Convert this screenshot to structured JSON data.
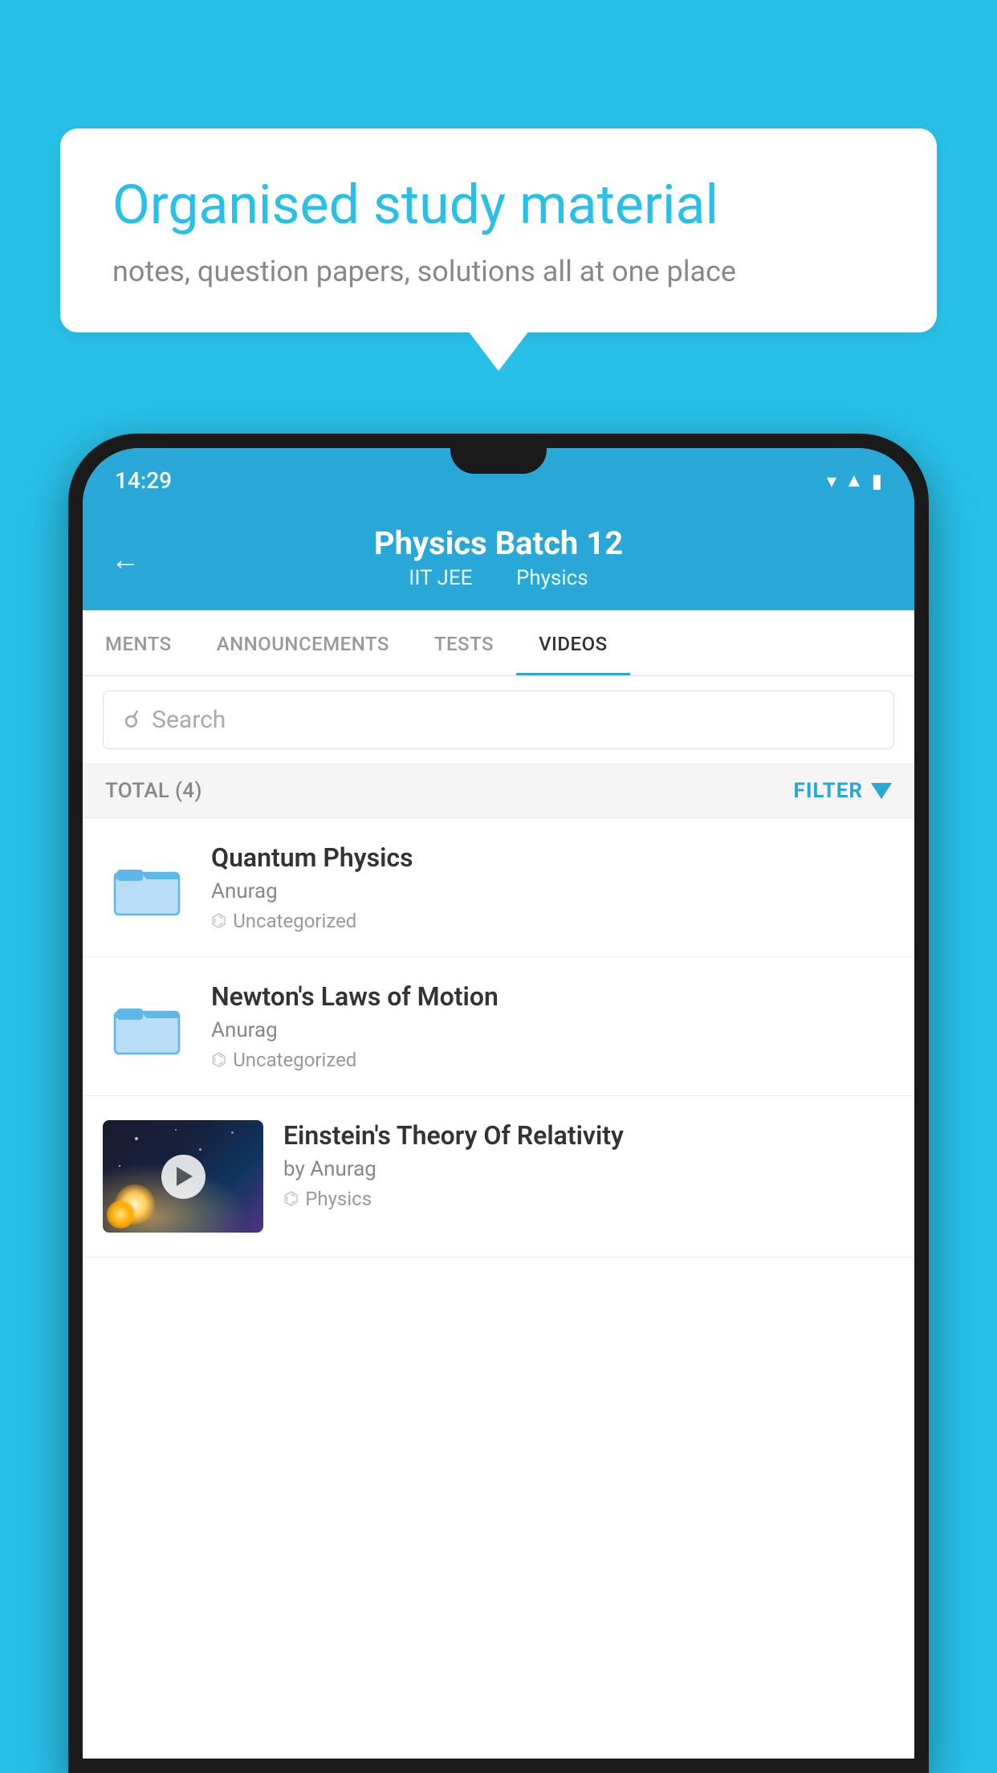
{
  "background_color": "#29C0E8",
  "bubble": {
    "title": "Organised study material",
    "subtitle": "notes, question papers, solutions all at one place"
  },
  "status_bar": {
    "time": "14:29",
    "wifi": "▾",
    "signal": "▴",
    "battery": "▮"
  },
  "header": {
    "back_label": "←",
    "title": "Physics Batch 12",
    "subtitle_part1": "IIT JEE",
    "subtitle_part2": "Physics"
  },
  "tabs": [
    {
      "label": "MENTS",
      "active": false
    },
    {
      "label": "ANNOUNCEMENTS",
      "active": false
    },
    {
      "label": "TESTS",
      "active": false
    },
    {
      "label": "VIDEOS",
      "active": true
    }
  ],
  "search": {
    "placeholder": "Search"
  },
  "filter_bar": {
    "total_label": "TOTAL (4)",
    "filter_label": "FILTER"
  },
  "videos": [
    {
      "title": "Quantum Physics",
      "author": "Anurag",
      "tag": "Uncategorized",
      "type": "folder",
      "has_thumb": false
    },
    {
      "title": "Newton's Laws of Motion",
      "author": "Anurag",
      "tag": "Uncategorized",
      "type": "folder",
      "has_thumb": false
    },
    {
      "title": "Einstein's Theory Of Relativity",
      "author": "by Anurag",
      "tag": "Physics",
      "type": "video",
      "has_thumb": true
    }
  ]
}
